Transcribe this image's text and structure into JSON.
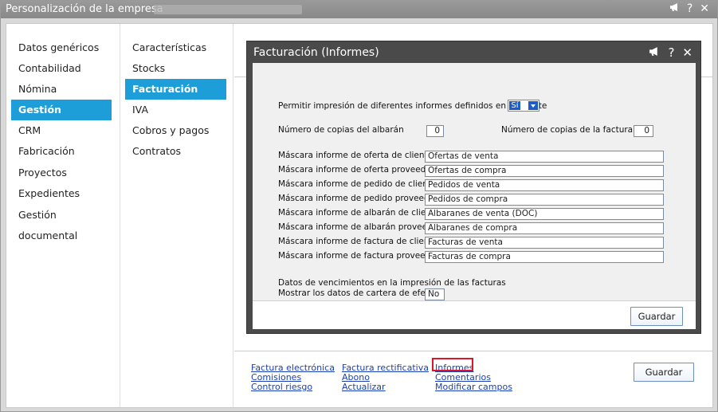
{
  "window": {
    "title": "Personalización de la empresa",
    "icons": [
      "megaphone-icon",
      "help-icon",
      "close-icon"
    ]
  },
  "sidebar": {
    "items": [
      {
        "label": "Datos genéricos",
        "active": false
      },
      {
        "label": "Contabilidad",
        "active": false
      },
      {
        "label": "Nómina",
        "active": false
      },
      {
        "label": "Gestión",
        "active": true
      },
      {
        "label": "CRM",
        "active": false
      },
      {
        "label": "Fabricación",
        "active": false
      },
      {
        "label": "Proyectos",
        "active": false
      },
      {
        "label": "Expedientes",
        "active": false
      },
      {
        "label": "Gestión documental",
        "active": false
      }
    ]
  },
  "subnav": {
    "items": [
      {
        "label": "Características",
        "active": false
      },
      {
        "label": "Stocks",
        "active": false
      },
      {
        "label": "Facturación",
        "active": true
      },
      {
        "label": "IVA",
        "active": false
      },
      {
        "label": "Cobros y pagos",
        "active": false
      },
      {
        "label": "Contratos",
        "active": false
      }
    ]
  },
  "dialog": {
    "title": "Facturación (Informes)",
    "allow_print_label": "Permitir impresión de diferentes informes definidos en el cliente",
    "allow_print_value": "Sí",
    "copies_albaran_label": "Número de copias del albarán",
    "copies_albaran_value": "0",
    "copies_factura_label": "Número de copias de la factura",
    "copies_factura_value": "0",
    "masks": [
      {
        "label": "Máscara informe de oferta de cliente",
        "value": "Ofertas de venta"
      },
      {
        "label": "Máscara informe de oferta proveedor",
        "value": "Ofertas de compra"
      },
      {
        "label": "Máscara informe de pedido de cliente",
        "value": "Pedidos de venta"
      },
      {
        "label": "Máscara informe de pedido proveedor",
        "value": "Pedidos de compra"
      },
      {
        "label": "Máscara informe de albarán de cliente",
        "value": "Albaranes de venta (DOC)"
      },
      {
        "label": "Máscara informe de albarán proveedor",
        "value": "Albaranes de compra"
      },
      {
        "label": "Máscara informe de factura de cliente",
        "value": "Facturas de venta"
      },
      {
        "label": "Máscara informe de factura proveedor",
        "value": "Facturas de compra"
      }
    ],
    "due_section_label": "Datos de vencimientos en la impresión de las facturas",
    "show_portfolio_label": "Mostrar los datos de cartera de efectos",
    "show_portfolio_value": "No",
    "save_label": "Guardar"
  },
  "links": {
    "factura_electronica": "Factura electrónica",
    "comisiones": "Comisiones",
    "control_riesgo": "Control riesgo",
    "factura_rectificativa": "Factura rectificativa",
    "abono": "Abono",
    "actualizar": "Actualizar",
    "informes": "Informes",
    "comentarios": "Comentarios",
    "modificar_campos": "Modificar campos"
  },
  "main": {
    "save_label": "Guardar"
  },
  "colors": {
    "accent": "#1e9ed8",
    "highlight": "#d9162b",
    "link": "#1a3fb5"
  }
}
